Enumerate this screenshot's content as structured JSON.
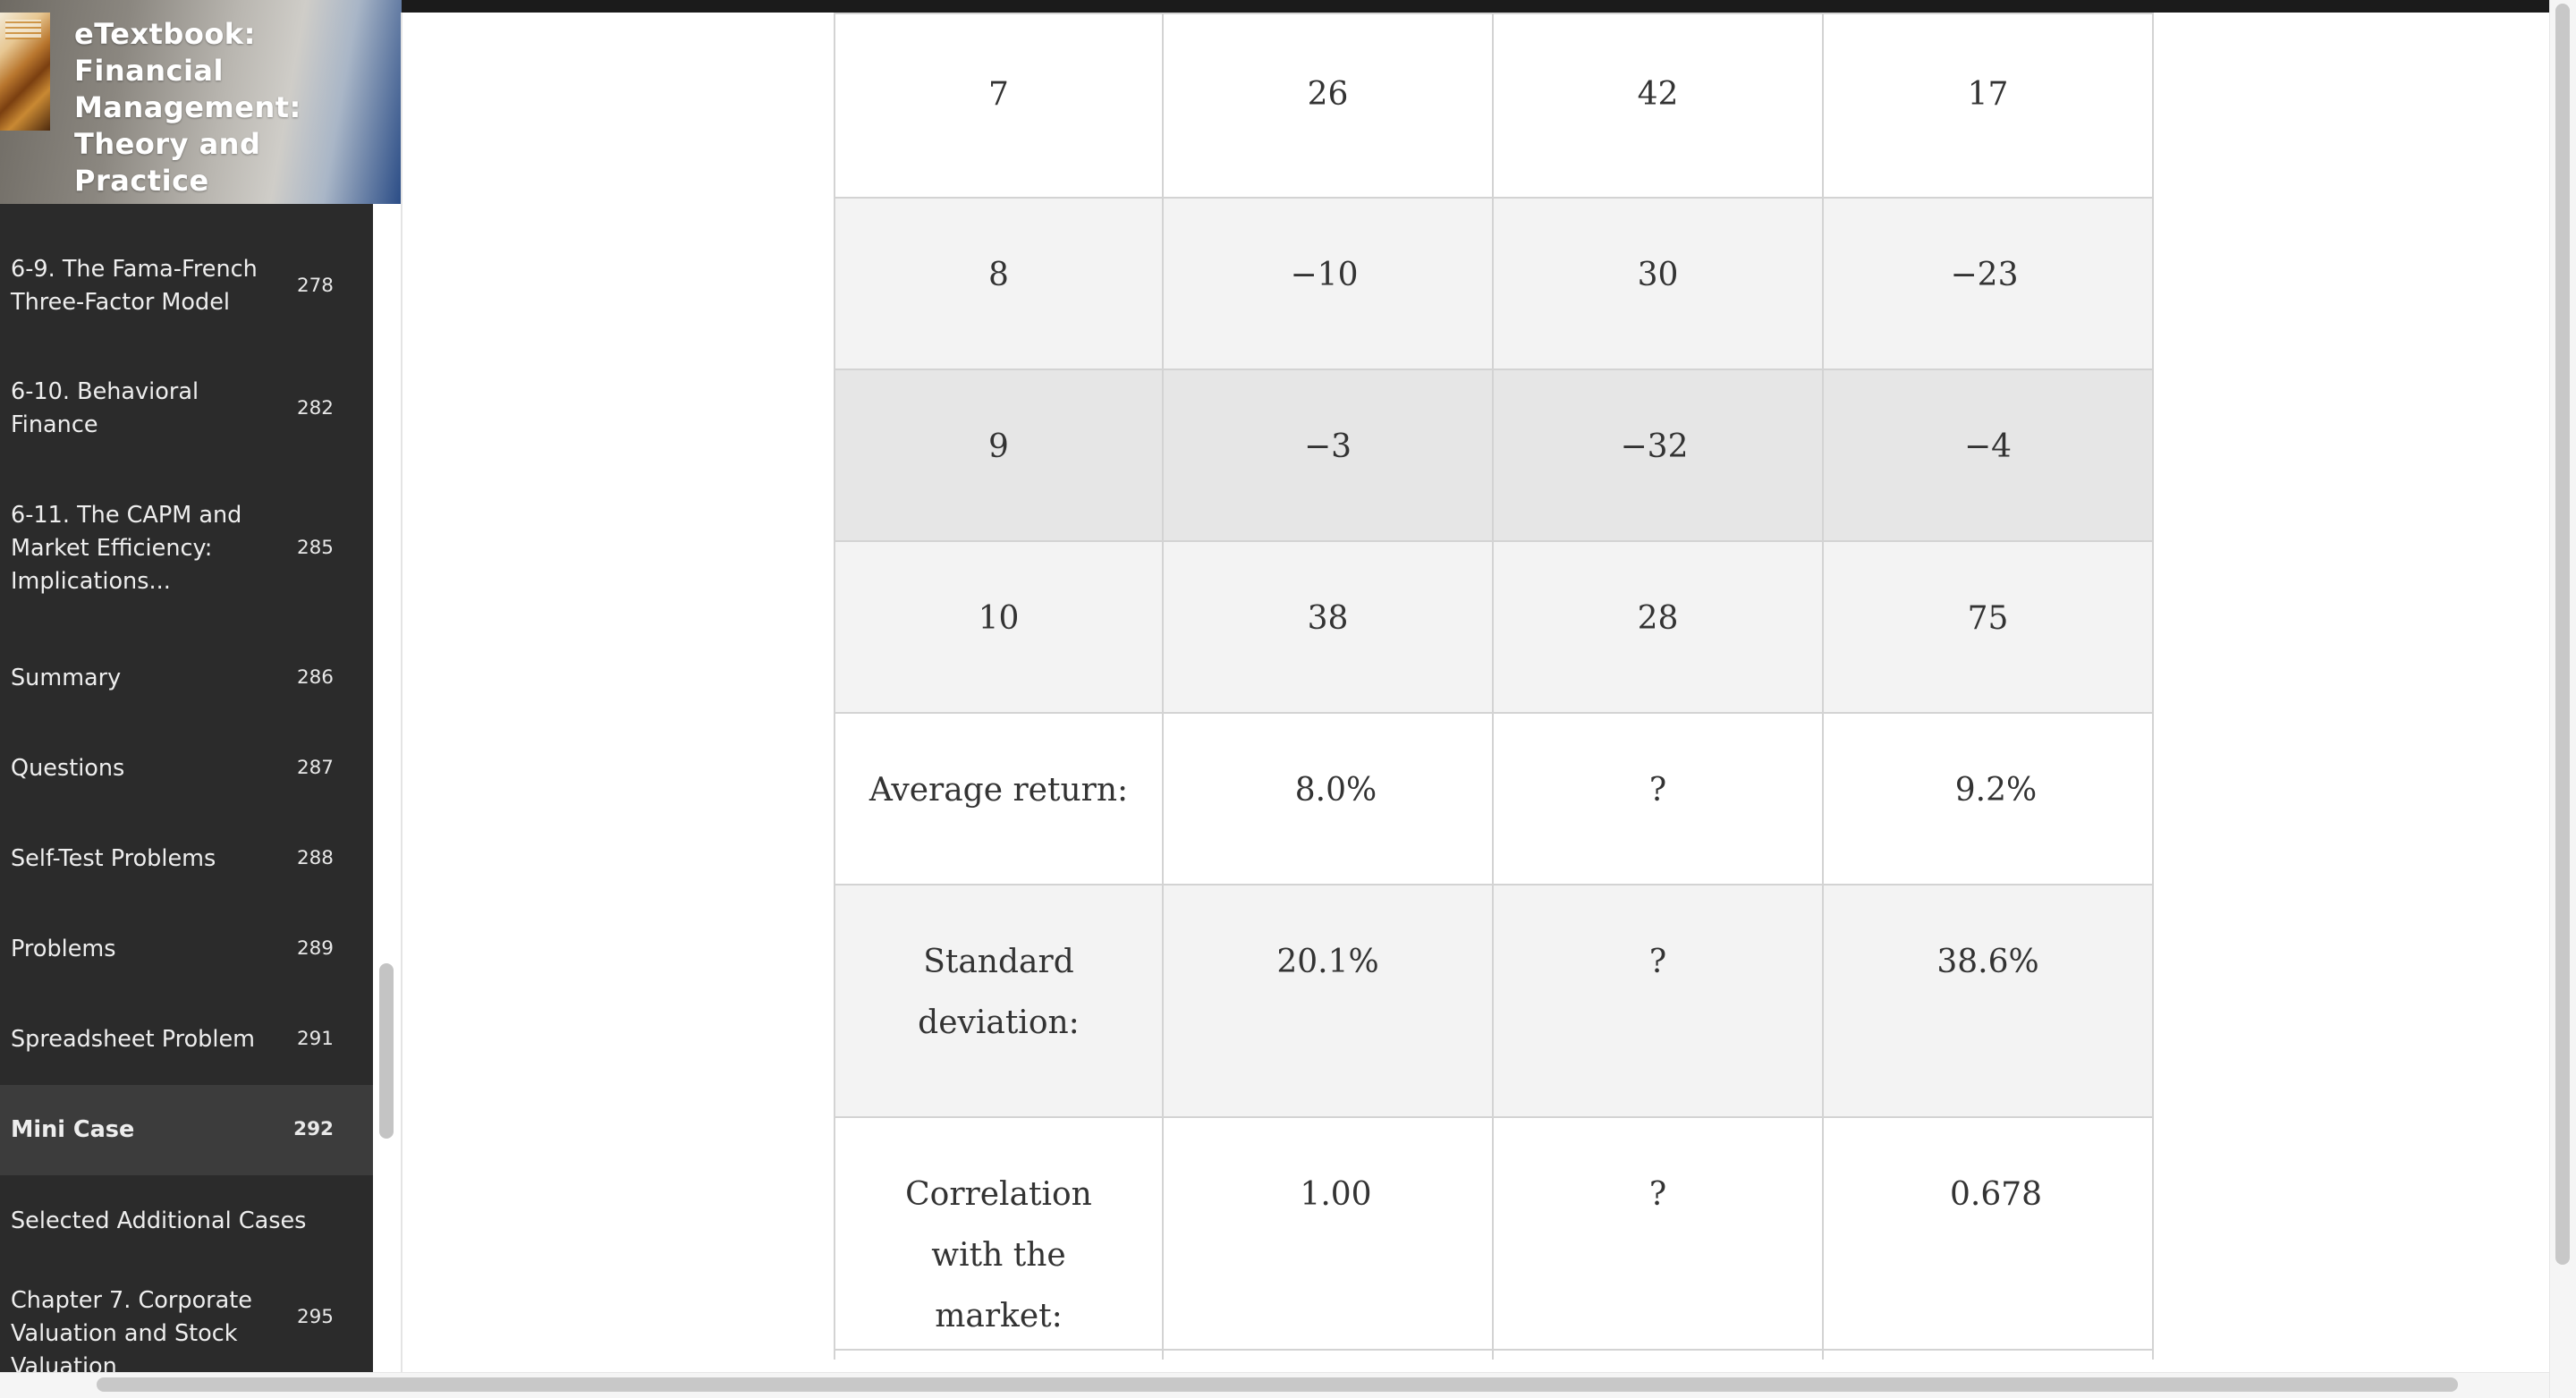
{
  "book": {
    "title_lines": [
      "eTextbook:",
      "Financial",
      "Management:",
      "Theory and",
      "Practice"
    ]
  },
  "toc": [
    {
      "label_lines": [
        "6-9. The Fama-French",
        "Three-Factor Model"
      ],
      "page": "278"
    },
    {
      "label_lines": [
        "6-10. Behavioral",
        "Finance"
      ],
      "page": "282"
    },
    {
      "label_lines": [
        "6-11. The CAPM and",
        "Market Efficiency:",
        "Implications..."
      ],
      "page": "285"
    },
    {
      "label_lines": [
        "Summary"
      ],
      "page": "286"
    },
    {
      "label_lines": [
        "Questions"
      ],
      "page": "287"
    },
    {
      "label_lines": [
        "Self-Test Problems"
      ],
      "page": "288"
    },
    {
      "label_lines": [
        "Problems"
      ],
      "page": "289"
    },
    {
      "label_lines": [
        "Spreadsheet Problem"
      ],
      "page": "291"
    },
    {
      "label_lines": [
        "Mini Case"
      ],
      "page": "292",
      "active": true
    },
    {
      "label_lines": [
        "Selected Additional Cases"
      ],
      "page": ""
    },
    {
      "label_lines": [
        "Chapter 7. Corporate",
        "Valuation and Stock",
        "Valuation"
      ],
      "page": "295"
    }
  ],
  "table": {
    "rows": [
      {
        "cells": [
          "7",
          "26",
          "42",
          "17"
        ]
      },
      {
        "cells": [
          "8",
          "−10",
          "30",
          "−23"
        ]
      },
      {
        "cells": [
          "9",
          "−3",
          "−32",
          "−4"
        ]
      },
      {
        "cells": [
          "10",
          "38",
          "28",
          "75"
        ]
      },
      {
        "cells": [
          "Average return:",
          "8.0%",
          "?",
          "9.2%"
        ]
      },
      {
        "cells": [
          "Standard deviation:",
          "20.1%",
          "?",
          "38.6%"
        ]
      },
      {
        "cells": [
          "Correlation with the market:",
          "1.00",
          "?",
          "0.678"
        ]
      }
    ]
  },
  "colors": {
    "sidebar_bg": "#2b2b2b",
    "sidebar_active_bg": "#3c3c3c",
    "row_white": "#ffffff",
    "row_light": "#f3f3f3",
    "row_mid": "#e6e6e6",
    "table_text": "#333333"
  }
}
